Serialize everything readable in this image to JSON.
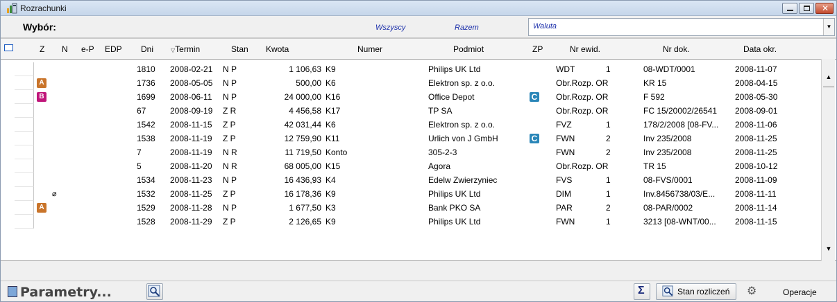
{
  "window": {
    "title": "Rozrachunki"
  },
  "selection": {
    "label": "Wybór:",
    "wszyscy": "Wszyscy",
    "razem": "Razem",
    "waluta": "Waluta"
  },
  "columns": [
    "Z",
    "N",
    "e-P",
    "EDP",
    "Dni",
    "Termin",
    "Stan",
    "Kwota",
    "Numer",
    "Podmiot",
    "ZP",
    "Nr ewid.",
    "Nr dok.",
    "Data okr."
  ],
  "rows": [
    {
      "badge": "",
      "clip": false,
      "dni": "1810",
      "termin": "2008-02-21",
      "stan": "N P",
      "kwota": "1 106,63",
      "numer": "K9",
      "podmiot": "Philips UK Ltd",
      "zp": "",
      "ewid": "WDT",
      "ewid_n": "1",
      "nrdok": "08-WDT/0001",
      "data": "2008-11-07"
    },
    {
      "badge": "A",
      "clip": false,
      "dni": "1736",
      "termin": "2008-05-05",
      "stan": "N P",
      "kwota": "500,00",
      "numer": "K6",
      "podmiot": "Elektron sp. z o.o.",
      "zp": "",
      "ewid": "Obr.Rozp. OR",
      "ewid_n": "",
      "nrdok": "KR 15",
      "data": "2008-04-15"
    },
    {
      "badge": "B",
      "clip": false,
      "dni": "1699",
      "termin": "2008-06-11",
      "stan": "N P",
      "kwota": "24 000,00",
      "numer": "K16",
      "podmiot": "Office Depot",
      "zp": "C",
      "ewid": "Obr.Rozp. OR",
      "ewid_n": "",
      "nrdok": "F 592",
      "data": "2008-05-30"
    },
    {
      "badge": "",
      "clip": false,
      "dni": "67",
      "termin": "2008-09-19",
      "stan": "Z R",
      "kwota": "4 456,58",
      "numer": "K17",
      "podmiot": "TP SA",
      "zp": "",
      "ewid": "Obr.Rozp. OR",
      "ewid_n": "",
      "nrdok": "FC 15/20002/26541",
      "data": "2008-09-01"
    },
    {
      "badge": "",
      "clip": false,
      "dni": "1542",
      "termin": "2008-11-15",
      "stan": "Z P",
      "kwota": "42 031,44",
      "numer": "K6",
      "podmiot": "Elektron sp. z o.o.",
      "zp": "",
      "ewid": "FVZ",
      "ewid_n": "1",
      "nrdok": "178/2/2008 [08-FV...",
      "data": "2008-11-06"
    },
    {
      "badge": "",
      "clip": false,
      "dni": "1538",
      "termin": "2008-11-19",
      "stan": "Z P",
      "kwota": "12 759,90",
      "numer": "K11",
      "podmiot": "Urlich von J GmbH",
      "zp": "C",
      "ewid": "FWN",
      "ewid_n": "2",
      "nrdok": "Inv 235/2008",
      "data": "2008-11-25"
    },
    {
      "badge": "",
      "clip": false,
      "dni": "7",
      "termin": "2008-11-19",
      "stan": "N R",
      "kwota": "11 719,50",
      "numer": "Konto",
      "podmiot": "305-2-3",
      "zp": "",
      "ewid": "FWN",
      "ewid_n": "2",
      "nrdok": "Inv 235/2008",
      "data": "2008-11-25"
    },
    {
      "badge": "",
      "clip": false,
      "dni": "5",
      "termin": "2008-11-20",
      "stan": "N R",
      "kwota": "68 005,00",
      "numer": "K15",
      "podmiot": "Agora",
      "zp": "",
      "ewid": "Obr.Rozp. OR",
      "ewid_n": "",
      "nrdok": "TR 15",
      "data": "2008-10-12"
    },
    {
      "badge": "",
      "clip": false,
      "dni": "1534",
      "termin": "2008-11-23",
      "stan": "N P",
      "kwota": "16 436,93",
      "numer": "K4",
      "podmiot": "Edelw Zwierzyniec",
      "zp": "",
      "ewid": "FVS",
      "ewid_n": "1",
      "nrdok": "08-FVS/0001",
      "data": "2008-11-09"
    },
    {
      "badge": "",
      "clip": true,
      "dni": "1532",
      "termin": "2008-11-25",
      "stan": "Z P",
      "kwota": "16 178,36",
      "numer": "K9",
      "podmiot": "Philips UK Ltd",
      "zp": "",
      "ewid": "DIM",
      "ewid_n": "1",
      "nrdok": "Inv.8456738/03/E...",
      "data": "2008-11-11"
    },
    {
      "badge": "A",
      "clip": false,
      "dni": "1529",
      "termin": "2008-11-28",
      "stan": "N P",
      "kwota": "1 677,50",
      "numer": "K3",
      "podmiot": "Bank PKO SA",
      "zp": "",
      "ewid": "PAR",
      "ewid_n": "2",
      "nrdok": "08-PAR/0002",
      "data": "2008-11-14"
    },
    {
      "badge": "",
      "clip": false,
      "dni": "1528",
      "termin": "2008-11-29",
      "stan": "Z P",
      "kwota": "2 126,65",
      "numer": "K9",
      "podmiot": "Philips UK Ltd",
      "zp": "",
      "ewid": "FWN",
      "ewid_n": "1",
      "nrdok": "3213 [08-WNT/00...",
      "data": "2008-11-15"
    }
  ],
  "bottom": {
    "parametry": "Parametry...",
    "stan_rozliczen": "Stan rozliczeń",
    "operacje": "Operacje"
  }
}
